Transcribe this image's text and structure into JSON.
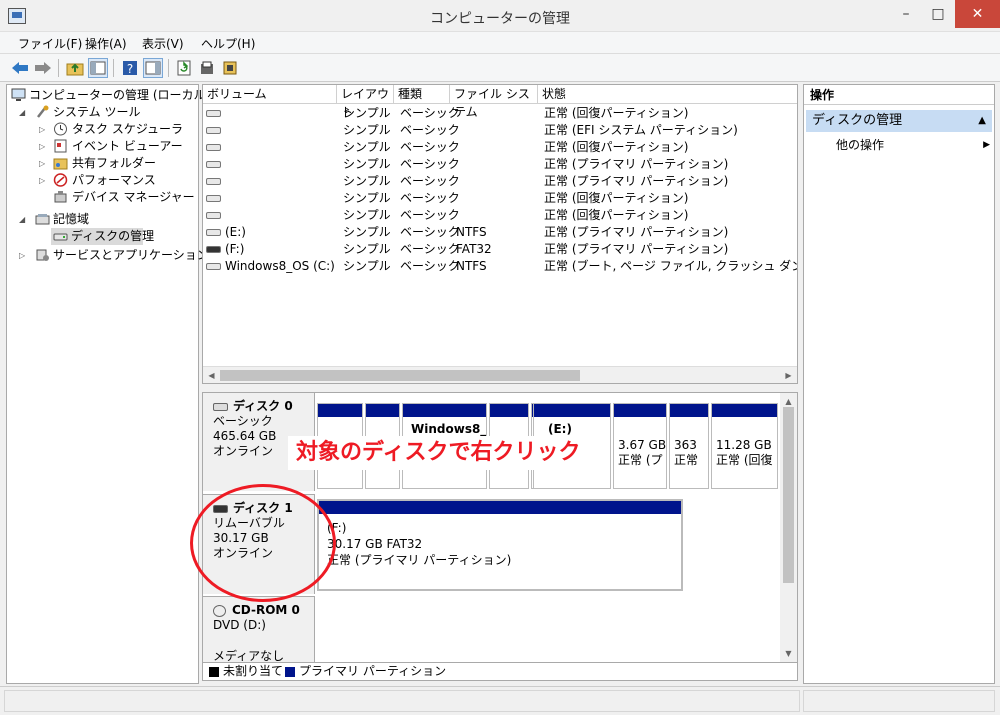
{
  "window": {
    "title": "コンピューターの管理",
    "minimize": "–",
    "maximize": "□",
    "close": "✕"
  },
  "menu": [
    "ファイル(F)",
    "操作(A)",
    "表示(V)",
    "ヘルプ(H)"
  ],
  "toolbar_icons": [
    "back-arrow-icon",
    "forward-arrow-icon",
    "folder-up-icon",
    "show-hide-tree-icon",
    "help-icon",
    "show-hide-action-icon",
    "refresh-icon",
    "properties-icon",
    "export-icon"
  ],
  "tree": {
    "items": [
      {
        "label": "コンピューターの管理 (ローカル)",
        "level": 0,
        "expander": "",
        "icon": "computer-icon"
      },
      {
        "label": "システム ツール",
        "level": 1,
        "expander": "◢",
        "icon": "tools-icon"
      },
      {
        "label": "タスク スケジューラ",
        "level": 2,
        "expander": "▷",
        "icon": "clock-icon"
      },
      {
        "label": "イベント ビューアー",
        "level": 2,
        "expander": "▷",
        "icon": "event-viewer-icon"
      },
      {
        "label": "共有フォルダー",
        "level": 2,
        "expander": "▷",
        "icon": "shared-folder-icon"
      },
      {
        "label": "パフォーマンス",
        "level": 2,
        "expander": "▷",
        "icon": "performance-icon"
      },
      {
        "label": "デバイス マネージャー",
        "level": 2,
        "expander": "",
        "icon": "device-manager-icon"
      },
      {
        "label": "記憶域",
        "level": 1,
        "expander": "◢",
        "icon": "storage-icon"
      },
      {
        "label": "ディスクの管理",
        "level": 2,
        "expander": "",
        "icon": "disk-management-icon",
        "selected": true
      },
      {
        "label": "サービスとアプリケーション",
        "level": 1,
        "expander": "▷",
        "icon": "services-icon"
      }
    ]
  },
  "volumes": {
    "columns": [
      "ボリューム",
      "レイアウト",
      "種類",
      "ファイル システム",
      "状態"
    ],
    "rows": [
      {
        "volume": "",
        "layout": "シンプル",
        "type": "ベーシック",
        "fs": "",
        "status": "正常 (回復パーティション)",
        "dark": false
      },
      {
        "volume": "",
        "layout": "シンプル",
        "type": "ベーシック",
        "fs": "",
        "status": "正常 (EFI システム パーティション)",
        "dark": false
      },
      {
        "volume": "",
        "layout": "シンプル",
        "type": "ベーシック",
        "fs": "",
        "status": "正常 (回復パーティション)",
        "dark": false
      },
      {
        "volume": "",
        "layout": "シンプル",
        "type": "ベーシック",
        "fs": "",
        "status": "正常 (プライマリ パーティション)",
        "dark": false
      },
      {
        "volume": "",
        "layout": "シンプル",
        "type": "ベーシック",
        "fs": "",
        "status": "正常 (プライマリ パーティション)",
        "dark": false
      },
      {
        "volume": "",
        "layout": "シンプル",
        "type": "ベーシック",
        "fs": "",
        "status": "正常 (回復パーティション)",
        "dark": false
      },
      {
        "volume": "",
        "layout": "シンプル",
        "type": "ベーシック",
        "fs": "",
        "status": "正常 (回復パーティション)",
        "dark": false
      },
      {
        "volume": "(E:)",
        "layout": "シンプル",
        "type": "ベーシック",
        "fs": "NTFS",
        "status": "正常 (プライマリ パーティション)",
        "dark": false
      },
      {
        "volume": "(F:)",
        "layout": "シンプル",
        "type": "ベーシック",
        "fs": "FAT32",
        "status": "正常 (プライマリ パーティション)",
        "dark": true
      },
      {
        "volume": "Windows8_OS (C:)",
        "layout": "シンプル",
        "type": "ベーシック",
        "fs": "NTFS",
        "status": "正常 (ブート, ページ ファイル, クラッシュ ダンプ, プライマ",
        "dark": false
      }
    ]
  },
  "disks": {
    "disk0": {
      "name": "ディスク 0",
      "kind": "ベーシック",
      "size": "465.64 GB",
      "state": "オンライン",
      "partitions": [
        {
          "title": "",
          "line1": "",
          "line2": ""
        },
        {
          "title": "",
          "line1": "",
          "line2": ""
        },
        {
          "title": "Windows8_",
          "line1": "",
          "line2": ""
        },
        {
          "title": "",
          "line1": "",
          "line2": ""
        },
        {
          "title": "",
          "line1": "",
          "line2": ""
        },
        {
          "title": "(E:)",
          "line1": "",
          "line2": ""
        },
        {
          "title": "",
          "line1": "3.67 GB",
          "line2": "正常 (プ"
        },
        {
          "title": "",
          "line1": "363",
          "line2": "正常"
        },
        {
          "title": "",
          "line1": "11.28 GB",
          "line2": "正常 (回復"
        }
      ]
    },
    "disk1": {
      "name": "ディスク 1",
      "kind": "リムーバブル",
      "size": "30.17 GB",
      "state": "オンライン",
      "partition": {
        "title": "(F:)",
        "line1": "30.17 GB FAT32",
        "line2": "正常 (プライマリ パーティション)"
      }
    },
    "cdrom0": {
      "name": "CD-ROM 0",
      "drive": "DVD (D:)",
      "media": "メディアなし"
    }
  },
  "legend": [
    {
      "label": "未割り当て",
      "color": "#000000"
    },
    {
      "label": "プライマリ パーティション",
      "color": "#00148c"
    }
  ],
  "annotation": {
    "callout": "対象のディスクで右クリック",
    "color": "#ee1b24"
  },
  "actions": {
    "header": "操作",
    "selected": "ディスクの管理",
    "selected_arrow": "▲",
    "item": "他の操作",
    "item_arrow": "▶"
  }
}
